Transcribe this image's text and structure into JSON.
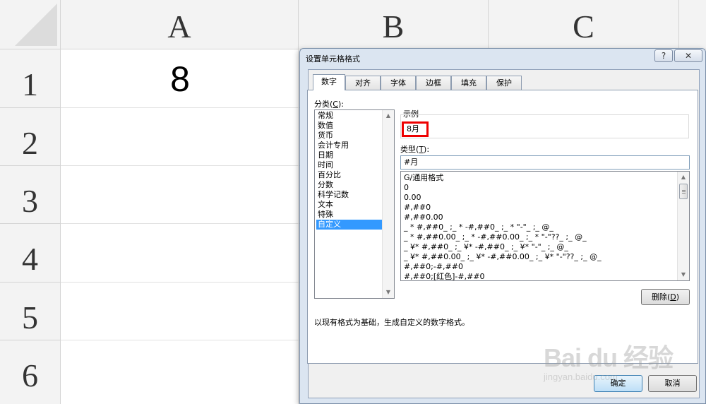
{
  "sheet": {
    "columns": [
      "A",
      "B",
      "C"
    ],
    "rows": [
      "1",
      "2",
      "3",
      "4",
      "5",
      "6"
    ],
    "cell_a1": "8"
  },
  "dialog": {
    "title": "设置单元格格式",
    "help_label": "?",
    "close_label": "✕",
    "tabs": [
      "数字",
      "对齐",
      "字体",
      "边框",
      "填充",
      "保护"
    ],
    "category_label": "分类(",
    "category_key": "C",
    "category_label_end": "):",
    "categories": [
      "常规",
      "数值",
      "货币",
      "会计专用",
      "日期",
      "时间",
      "百分比",
      "分数",
      "科学记数",
      "文本",
      "特殊",
      "自定义"
    ],
    "selected_category": "自定义",
    "sample_label": "示例",
    "sample_value": "8月",
    "type_label": "类型(",
    "type_key": "T",
    "type_label_end": "):",
    "type_value": "#月",
    "formats": [
      "G/通用格式",
      "0",
      "0.00",
      "#,##0",
      "#,##0.00",
      "_ * #,##0_ ;_ * -#,##0_ ;_ * \"-\"_ ;_ @_",
      "_ * #,##0.00_ ;_ * -#,##0.00_ ;_ * \"-\"??_ ;_ @_",
      "_ ¥* #,##0_ ;_ ¥* -#,##0_ ;_ ¥* \"-\"_ ;_ @_",
      "_ ¥* #,##0.00_ ;_ ¥* -#,##0.00_ ;_ ¥* \"-\"??_ ;_ @_",
      "#,##0;-#,##0",
      "#,##0;[红色]-#,##0"
    ],
    "delete_label": "删除(",
    "delete_key": "D",
    "delete_label_end": ")",
    "hint": "以现有格式为基础，生成自定义的数字格式。",
    "ok_label": "确定",
    "cancel_label": "取消"
  },
  "watermark": {
    "main": "Bai du 经验",
    "sub": "jingyan.baidu.com"
  }
}
